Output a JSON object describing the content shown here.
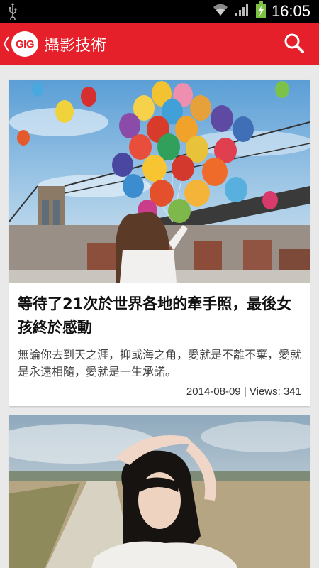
{
  "statusbar": {
    "time": "16:05"
  },
  "appbar": {
    "logo_text": "GIG",
    "title": "攝影技術"
  },
  "articles": [
    {
      "title": "等待了21次於世界各地的牽手照，最後女孩終於感動",
      "excerpt": "無論你去到天之涯，抑或海之角，愛就是不離不棄，愛就是永遠相隨，愛就是一生承諾。",
      "date": "2014-08-09",
      "views": "Views: 341",
      "meta": "2014-08-09 | Views: 341"
    },
    {
      "title": "",
      "excerpt": ""
    }
  ],
  "colors": {
    "accent": "#e6202a",
    "statusbar": "#000000",
    "background": "#e9e9e9"
  },
  "icons": [
    "usb-icon",
    "wifi-icon",
    "signal-icon",
    "battery-charging-icon",
    "back-chevron-icon",
    "search-icon"
  ]
}
